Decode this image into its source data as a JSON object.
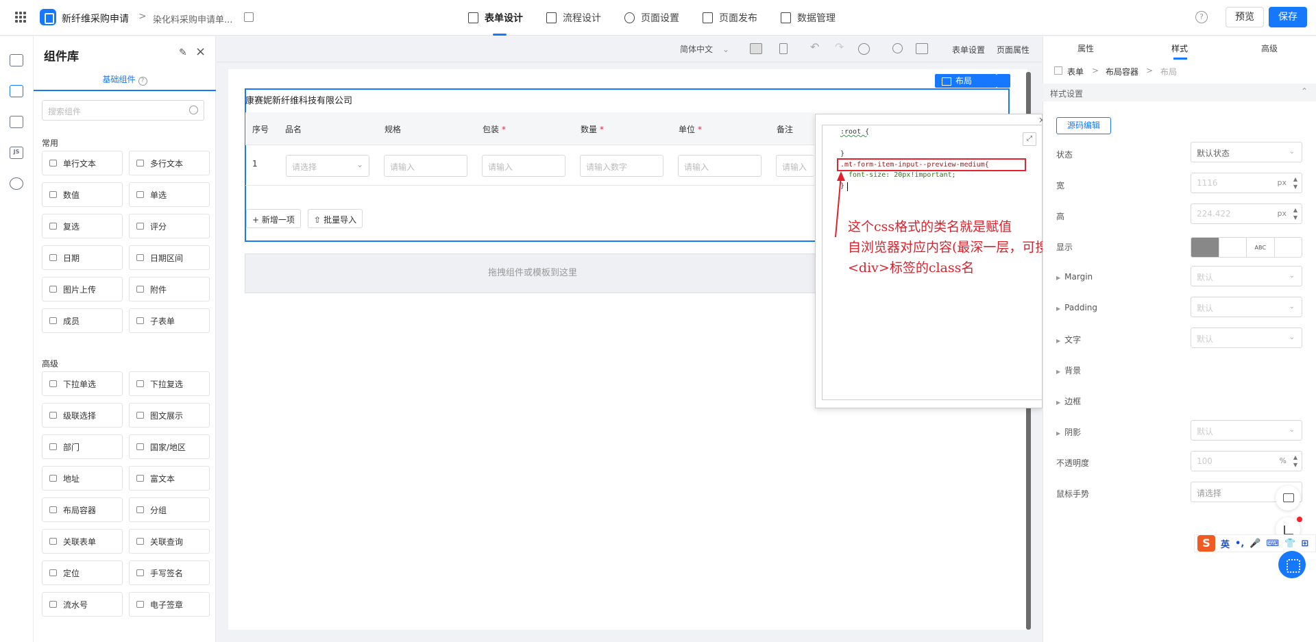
{
  "header": {
    "app_name": "新纤维采购申请",
    "separator": ">",
    "page_name": "染化料采购申请单...",
    "nav": [
      {
        "label": "表单设计",
        "active": true
      },
      {
        "label": "流程设计",
        "active": false
      },
      {
        "label": "页面设置",
        "active": false
      },
      {
        "label": "页面发布",
        "active": false
      },
      {
        "label": "数据管理",
        "active": false
      }
    ],
    "help": "?",
    "preview_label": "预览",
    "save_label": "保存"
  },
  "colors": {
    "accent": "#1677ff",
    "annotation": "#e0202a",
    "required": "#f5222d"
  },
  "rail": {
    "items": [
      "outline-icon",
      "components-icon",
      "datasource-icon",
      "js-icon",
      "globe-icon"
    ],
    "js_label": "JS"
  },
  "library": {
    "title": "组件库",
    "tab_label": "基础组件",
    "help": "?",
    "search_placeholder": "搜索组件",
    "groups": [
      {
        "title": "常用",
        "items": [
          "单行文本",
          "多行文本",
          "数值",
          "单选",
          "复选",
          "评分",
          "日期",
          "日期区间",
          "图片上传",
          "附件",
          "成员",
          "子表单"
        ]
      },
      {
        "title": "高级",
        "items": [
          "下拉单选",
          "下拉复选",
          "级联选择",
          "图文展示",
          "部门",
          "国家/地区",
          "地址",
          "富文本",
          "布局容器",
          "分组",
          "关联表单",
          "关联查询",
          "定位",
          "手写签名",
          "流水号",
          "电子签章"
        ]
      }
    ]
  },
  "toolbar": {
    "language": "简体中文",
    "form_settings": "表单设置",
    "page_properties": "页面属性"
  },
  "canvas": {
    "selection_tag": "布局",
    "company": "康赛妮新纤维科技有限公司",
    "table": {
      "columns": [
        {
          "label": "序号",
          "required": false
        },
        {
          "label": "品名",
          "required": false
        },
        {
          "label": "规格",
          "required": false
        },
        {
          "label": "包装",
          "required": true
        },
        {
          "label": "数量",
          "required": true
        },
        {
          "label": "单位",
          "required": true
        },
        {
          "label": "备注",
          "required": false
        }
      ],
      "row_index": "1",
      "placeholders": [
        "请选择",
        "请输入",
        "请输入",
        "请输入数字",
        "请输入",
        "请输入"
      ],
      "required_mark": "*"
    },
    "add_row": "+ 新增一项",
    "batch_import": "批量导入",
    "dropzone": "拖拽组件或模板到这里"
  },
  "code_editor": {
    "close": "×",
    "expand": "⤢",
    "lines": [
      ":root {",
      "",
      "}",
      ".mt-form-item-input--preview-medium{",
      "  font-size: 20px!important;",
      "}"
    ],
    "annotation": [
      "这个css格式的类名就是赋值",
      "自浏览器对应内容(最深一层，可搜索)的",
      "<div>标签的class名"
    ]
  },
  "right_panel": {
    "tabs": [
      "属性",
      "样式",
      "高级"
    ],
    "active_tab": "样式",
    "breadcrumb": [
      "表单",
      "布局容器",
      "布局"
    ],
    "section_title": "样式设置",
    "source_edit": "源码编辑",
    "rows": {
      "state": {
        "label": "状态",
        "value": "默认状态"
      },
      "width": {
        "label": "宽",
        "value": "1116",
        "unit": "px"
      },
      "height": {
        "label": "高",
        "value": "224.422",
        "unit": "px"
      },
      "display": {
        "label": "显示",
        "options": [
          "",
          "",
          "ABC",
          ""
        ]
      },
      "margin": {
        "label": "Margin",
        "value": "默认"
      },
      "padding": {
        "label": "Padding",
        "value": "默认"
      },
      "text": {
        "label": "文字",
        "value": "默认"
      },
      "background": {
        "label": "背景"
      },
      "border": {
        "label": "边框"
      },
      "shadow": {
        "label": "阴影",
        "value": "默认"
      },
      "opacity": {
        "label": "不透明度",
        "value": "100",
        "unit": "%"
      },
      "cursor": {
        "label": "鼠标手势",
        "value": "请选择"
      }
    }
  },
  "ime": {
    "logo": "S",
    "items": [
      "英",
      "•,",
      "🎤",
      "⌨",
      "👕",
      "⊞"
    ]
  }
}
